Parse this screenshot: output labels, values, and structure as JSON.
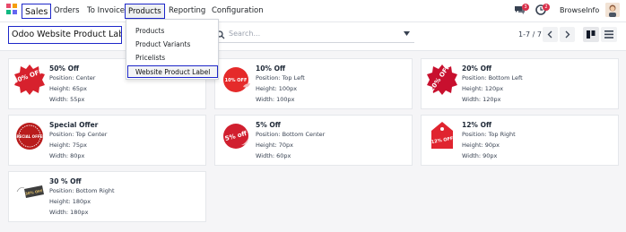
{
  "topbar": {
    "app_menu": "Sales",
    "menu_items": [
      "Orders",
      "To Invoice",
      "Products",
      "Reporting",
      "Configuration"
    ],
    "messages_badge": "3",
    "activities_badge": "2",
    "user_name": "BrowseInfo"
  },
  "products_menu": {
    "items": [
      "Products",
      "Product Variants",
      "Pricelists",
      "Website Product Label"
    ]
  },
  "control": {
    "breadcrumb": "Odoo Website Product Label",
    "search_placeholder": "Search...",
    "pager": "1-7 / 7"
  },
  "cards": [
    {
      "badge": "50% OFF",
      "title": "50% Off",
      "position": "Position: Center",
      "height": "Height: 65px",
      "width": "Width: 55px",
      "color": "#d7212d"
    },
    {
      "badge": "10% OFF",
      "title": "10% Off",
      "position": "Position: Top Left",
      "height": "Height: 100px",
      "width": "Width: 100px",
      "color": "#e52a2a"
    },
    {
      "badge": "20% OFF",
      "title": "20% Off",
      "position": "Position: Bottom Left",
      "height": "Height: 120px",
      "width": "Width: 120px",
      "color": "#c8102e"
    },
    {
      "badge": "SPECIAL OFFER",
      "title": "Special Offer",
      "position": "Position: Top Center",
      "height": "Height: 75px",
      "width": "Width: 80px",
      "color": "#b91c1c"
    },
    {
      "badge": "5% off",
      "title": "5% Off",
      "position": "Position: Bottom Center",
      "height": "Height: 70px",
      "width": "Width: 60px",
      "color": "#d11f2f"
    },
    {
      "badge": "12% OFF",
      "title": "12% Off",
      "position": "Position: Top Right",
      "height": "Height: 90px",
      "width": "Width: 90px",
      "color": "#e0242f"
    },
    {
      "badge": "30% OFF",
      "title": "30 % Off",
      "position": "Position: Bottom Right",
      "height": "Height: 180px",
      "width": "Width: 180px",
      "color": "#3d3d3d"
    }
  ],
  "colors": {
    "accent": "#1d27c9",
    "badge_red": "#d9304a"
  }
}
